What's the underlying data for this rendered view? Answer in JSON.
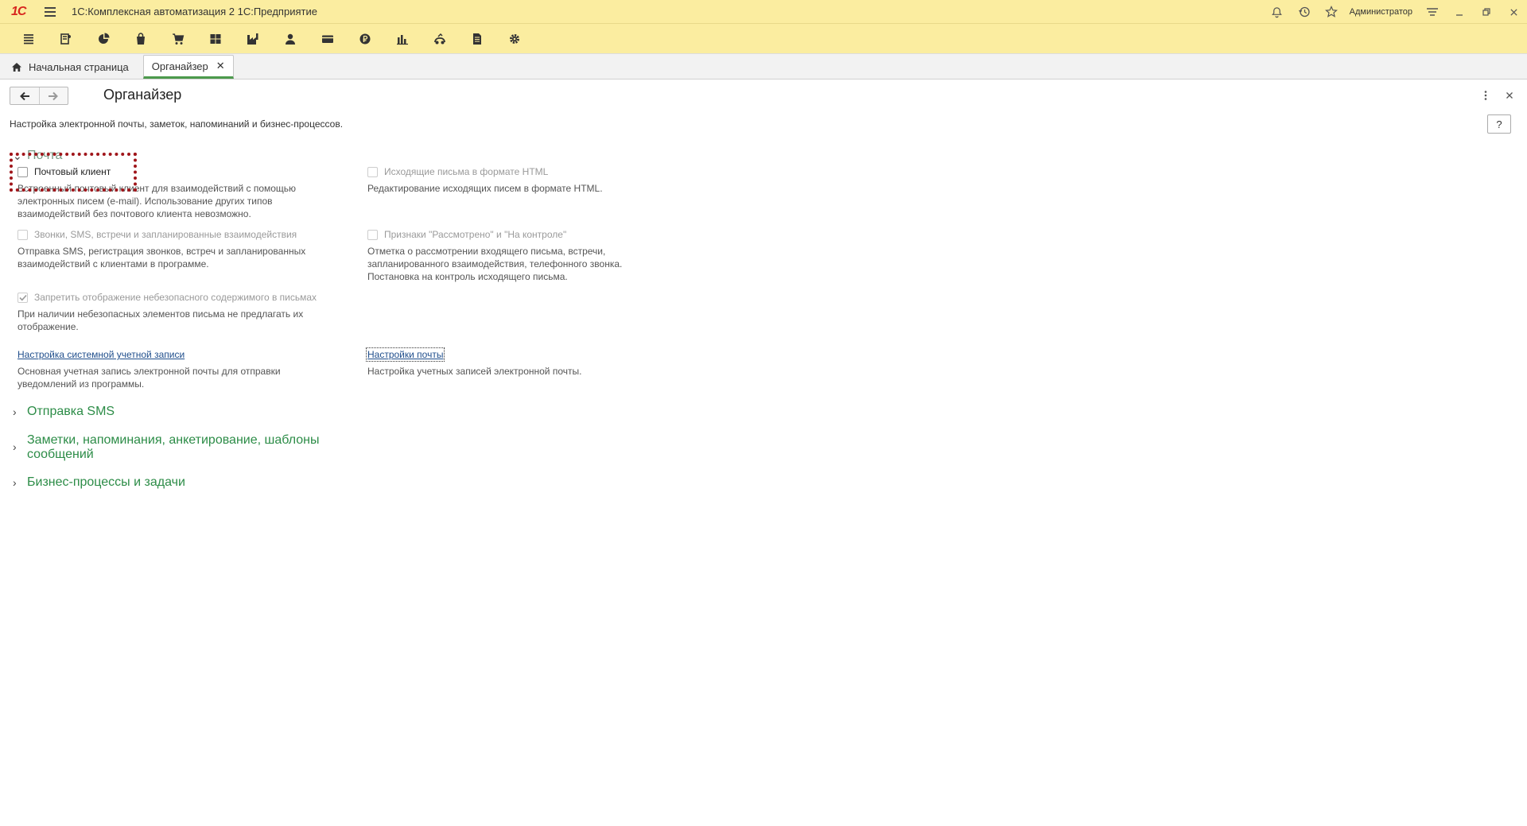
{
  "titlebar": {
    "logo_text": "1С",
    "app_title": "1С:Комплексная автоматизация 2 1С:Предприятие",
    "user_name": "Администратор"
  },
  "tabs": {
    "home_label": "Начальная страница",
    "active_label": "Органайзер"
  },
  "form": {
    "title": "Органайзер",
    "subtitle": "Настройка электронной почты, заметок, напоминаний и бизнес-процессов.",
    "help_label": "?"
  },
  "mail": {
    "title": "Почта",
    "mail_client": {
      "label": "Почтовый клиент",
      "desc1": "Встроенный почтовый клиент для взаимодействий с помощью",
      "desc2": "электронных писем (e-mail). Использование других типов",
      "desc3": "взаимодействий без почтового клиента невозможно."
    },
    "html_letters": {
      "label": "Исходящие письма в формате HTML",
      "desc1": "Редактирование исходящих писем в формате HTML."
    },
    "calls": {
      "label": "Звонки, SMS, встречи и запланированные взаимодействия",
      "desc1": "Отправка SMS, регистрация звонков, встреч и запланированных",
      "desc2": "взаимодействий с клиентами в программе."
    },
    "review_flags": {
      "label": "Признаки \"Рассмотрено\" и \"На контроле\"",
      "desc1": "Отметка о рассмотрении входящего письма, встречи,",
      "desc2": "запланированного взаимодействия, телефонного звонка.",
      "desc3": "Постановка на контроль исходящего письма."
    },
    "unsafe": {
      "label": "Запретить отображение небезопасного содержимого в письмах",
      "desc1": "При наличии небезопасных элементов письма не предлагать их",
      "desc2": "отображение."
    },
    "system_account": {
      "link": "Настройка системной учетной записи",
      "desc1": "Основная учетная запись электронной почты для отправки",
      "desc2": "уведомлений из программы."
    },
    "mail_settings": {
      "link": "Настройки почты",
      "desc1": "Настройка учетных записей электронной почты."
    }
  },
  "groups": {
    "sms": "Отправка SMS",
    "notes_line1": "Заметки, напоминания, анкетирование, шаблоны",
    "notes_line2": "сообщений",
    "bp": "Бизнес-процессы и задачи"
  }
}
